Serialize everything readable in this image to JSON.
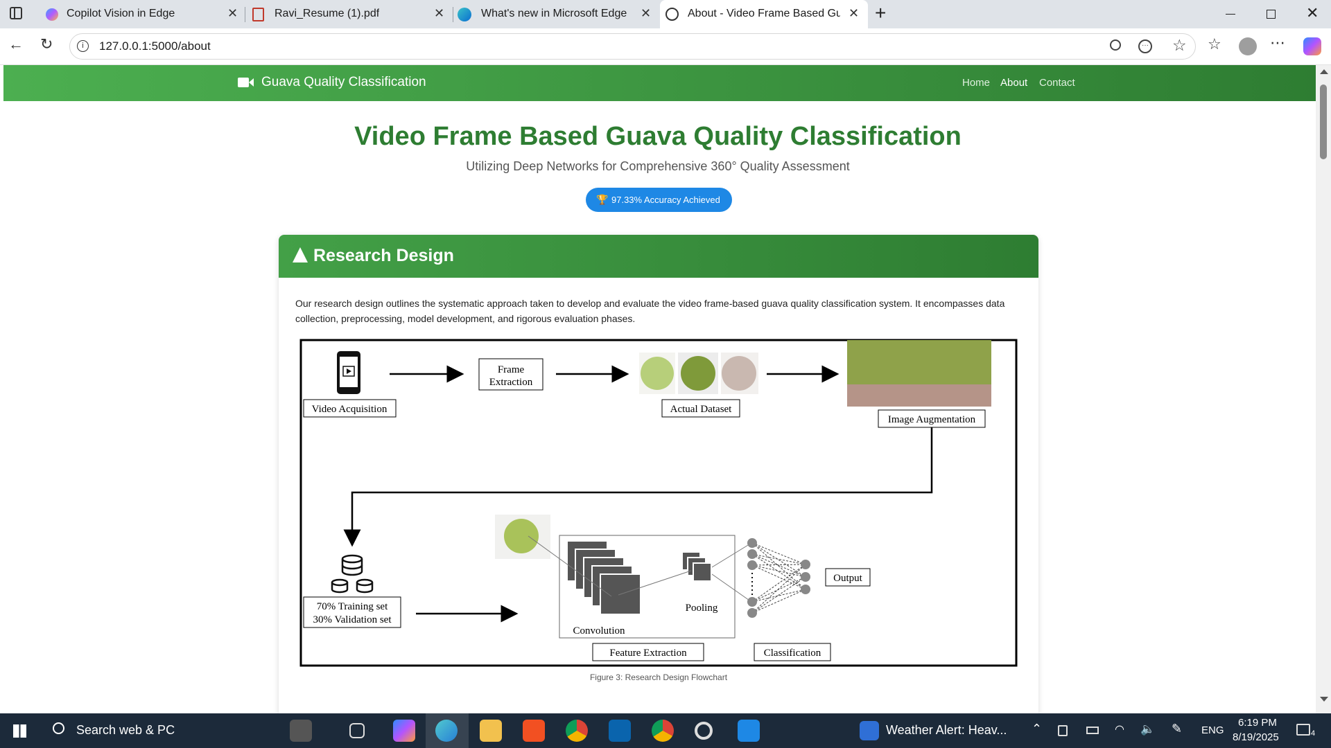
{
  "browser": {
    "tabs": [
      {
        "title": "Copilot Vision in Edge",
        "close": "✕"
      },
      {
        "title": "Ravi_Resume (1).pdf",
        "close": "✕"
      },
      {
        "title": "What's new in Microsoft Edge",
        "close": "✕"
      },
      {
        "title": "About - Video Frame Based Guav",
        "close": "✕"
      }
    ],
    "new_tab": "+",
    "url": "127.0.0.1:5000/about"
  },
  "site": {
    "brand": "Guava Quality Classification",
    "nav": [
      "Home",
      "About",
      "Contact"
    ],
    "title": "Video Frame Based Guava Quality Classification",
    "subtitle": "Utilizing Deep Networks for Comprehensive 360° Quality Assessment",
    "badge": "97.33% Accuracy Achieved",
    "section_title": "Research Design",
    "section_text": "Our research design outlines the systematic approach taken to develop and evaluate the video frame-based guava quality classification system. It encompasses data collection, preprocessing, model development, and rigorous evaluation phases.",
    "figure_caption": "Figure 3: Research Design Flowchart"
  },
  "flowchart": {
    "video_acquisition": "Video Acquisition",
    "frame_extraction_1": "Frame",
    "frame_extraction_2": "Extraction",
    "actual_dataset": "Actual Dataset",
    "image_augmentation": "Image Augmentation",
    "training_set": "70% Training set",
    "validation_set": "30% Validation set",
    "convolution": "Convolution",
    "pooling": "Pooling",
    "feature_extraction": "Feature Extraction",
    "classification": "Classification",
    "output": "Output"
  },
  "taskbar": {
    "search": "Search web & PC",
    "weather": "Weather Alert: Heav...",
    "lang": "ENG",
    "time": "6:19 PM",
    "date": "8/19/2025",
    "notif_count": "4"
  },
  "colors": {
    "brand_green": "#2e7d32",
    "badge_blue": "#1e88e5"
  }
}
